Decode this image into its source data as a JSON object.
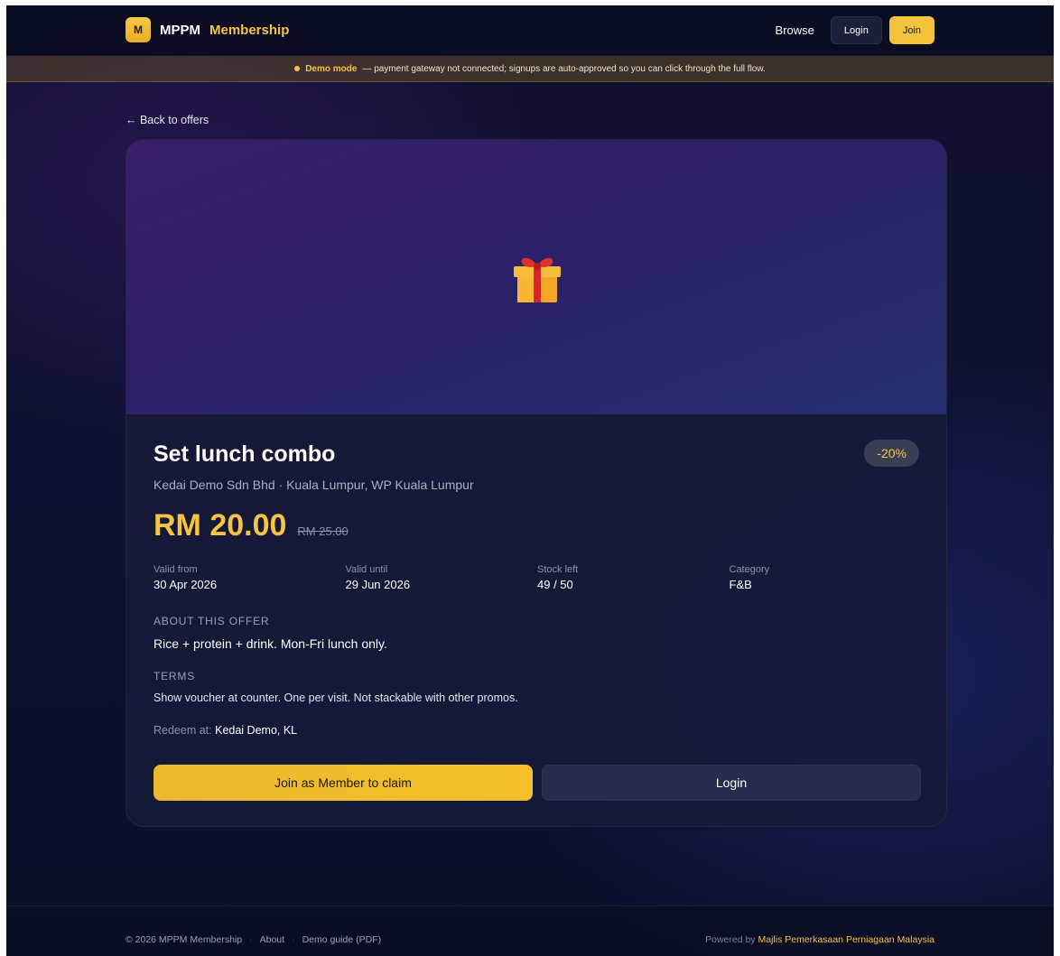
{
  "header": {
    "logo_letter": "M",
    "brand_name": "MPPM",
    "brand_accent": "Membership",
    "nav_browse": "Browse",
    "nav_login": "Login",
    "nav_join": "Join"
  },
  "banner": {
    "strong": "Demo mode",
    "text": "— payment gateway not connected; signups are auto-approved so you can click through the full flow."
  },
  "back_link": "← Back to offers",
  "offer": {
    "hero_icon": "gift-icon",
    "title": "Set lunch combo",
    "discount": "-20%",
    "merchant": "Kedai Demo Sdn Bhd · Kuala Lumpur, WP Kuala Lumpur",
    "price": "RM 20.00",
    "original_price": "RM 25.00",
    "meta": [
      {
        "label": "Valid from",
        "value": "30 Apr 2026"
      },
      {
        "label": "Valid until",
        "value": "29 Jun 2026"
      },
      {
        "label": "Stock left",
        "value": "49 / 50"
      },
      {
        "label": "Category",
        "value": "F&B"
      }
    ],
    "about_label": "ABOUT THIS OFFER",
    "about_text": "Rice + protein + drink. Mon-Fri lunch only.",
    "terms_label": "TERMS",
    "terms_text": "Show voucher at counter. One per visit. Not stackable with other promos.",
    "redeem_label": "Redeem at:",
    "redeem_value": "Kedai Demo, KL",
    "claim_button": "Join as Member to claim",
    "login_button": "Login"
  },
  "footer": {
    "copyright": "© 2026 MPPM Membership",
    "sep": "·",
    "about": "About",
    "demo_guide": "Demo guide (PDF)",
    "powered_by": "Powered by",
    "org": "Majlis Pemerkasaan Perniagaan Malaysia"
  },
  "colors": {
    "accent": "#f5c542",
    "background": "#0e1232",
    "card": "#161b38"
  }
}
